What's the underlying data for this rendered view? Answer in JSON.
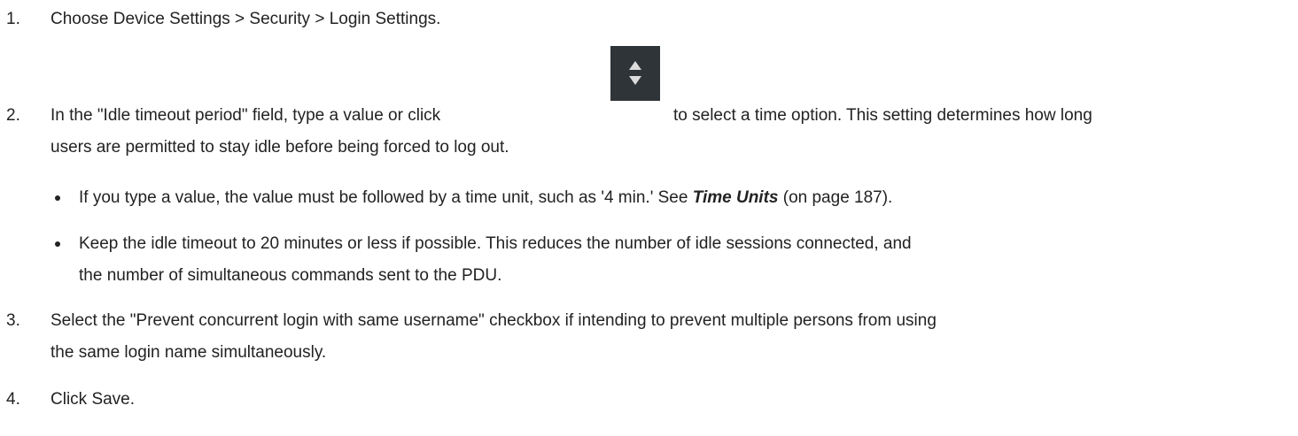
{
  "steps": [
    {
      "number": "1.",
      "text": "Choose Device Settings > Security > Login Settings."
    },
    {
      "number": "2.",
      "text_before": "In the \"Idle timeout period\" field, type a value or click",
      "text_after": "to select a time option. This setting determines how long",
      "text_line2": "users are permitted to stay idle before being forced to log out."
    },
    {
      "number": "3.",
      "text_line1": "Select the \"Prevent concurrent login with same username\" checkbox if intending to prevent multiple persons from using",
      "text_line2": "the same login name simultaneously."
    },
    {
      "number": "4.",
      "text": "Click Save."
    }
  ],
  "bullets": [
    {
      "text_before": "If you type a value, the value must be followed by a time unit, such as '4 min.' See ",
      "link": "Time Units",
      "text_after": " (on page 187)."
    },
    {
      "text_line1": "Keep the idle timeout to 20 minutes or less if possible. This reduces the number of idle sessions connected, and",
      "text_line2": "the number of simultaneous commands sent to the PDU."
    }
  ],
  "icons": {
    "spinner": "up-down-spinner-icon"
  },
  "colors": {
    "text": "#222222",
    "spinner_bg": "#2f3438",
    "spinner_arrows": "#dcdcdc"
  }
}
